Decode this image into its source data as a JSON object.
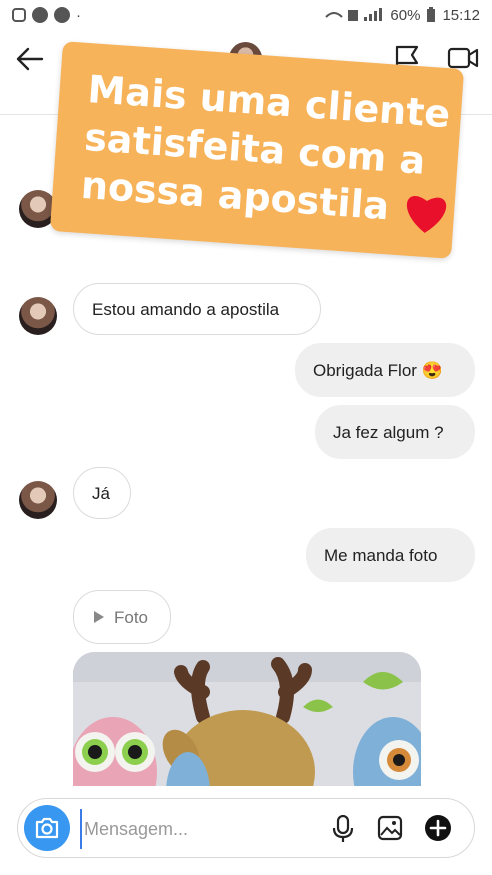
{
  "status_bar": {
    "battery": "60%",
    "time": "15:12"
  },
  "colors": {
    "accent": "#3897f0",
    "sticker_bg": "#f7b35a",
    "outgoing_bubble": "#efefef",
    "heart": "#e8102b"
  },
  "header": {
    "back_icon": "arrow-left-icon",
    "flag_icon": "flag-icon",
    "video_icon": "video-camera-icon"
  },
  "messages": [
    {
      "side": "in",
      "text": "Estou amando a apostila"
    },
    {
      "side": "out",
      "text": "Obrigada Flor 😍"
    },
    {
      "side": "out",
      "text": "Ja fez algum ?"
    },
    {
      "side": "in",
      "text": "Já"
    },
    {
      "side": "out",
      "text": "Me manda foto"
    },
    {
      "side": "in",
      "text": "Foto",
      "type": "photo-label"
    }
  ],
  "sticker": {
    "lines": [
      "Mais uma cliente",
      "satisfeita com a",
      "nossa apostila"
    ]
  },
  "composer": {
    "placeholder": "Mensagem...",
    "camera_icon": "camera-icon",
    "mic_icon": "microphone-icon",
    "gallery_icon": "image-gallery-icon",
    "plus_icon": "plus-circle-icon"
  }
}
